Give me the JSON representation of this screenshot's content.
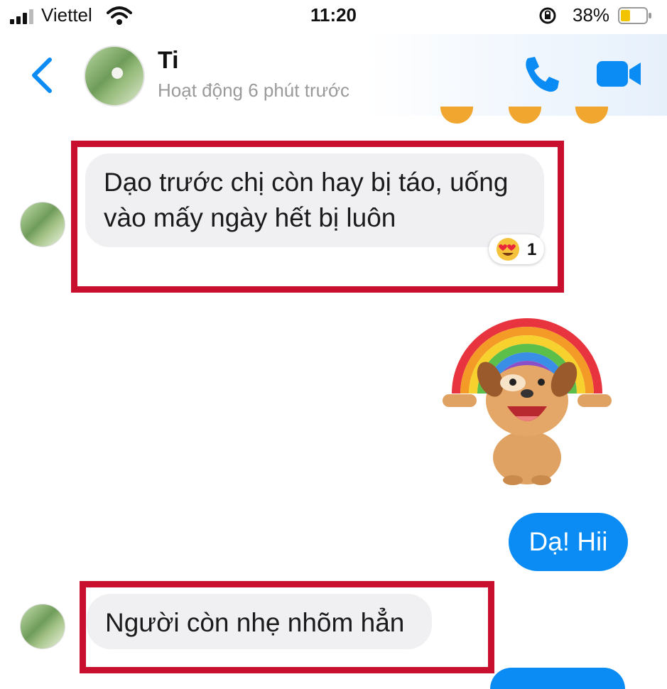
{
  "status_bar": {
    "carrier": "Viettel",
    "time": "11:20",
    "battery_percent": "38%",
    "battery_level": 0.38
  },
  "header": {
    "contact_name": "Ti",
    "contact_status": "Hoạt động 6 phút trước",
    "back_icon": "chevron-left-icon",
    "phone_icon": "phone-icon",
    "video_icon": "video-camera-icon"
  },
  "messages": [
    {
      "direction": "incoming",
      "lines": [
        "Dạo trước chị còn hay bị táo, uống",
        "vào mấy ngày hết bị luôn"
      ],
      "reaction": {
        "emoji": "heart-eyes-emoji",
        "count": "1"
      }
    },
    {
      "direction": "outgoing",
      "type": "sticker",
      "sticker": "rainbow-dog-sticker"
    },
    {
      "direction": "outgoing",
      "text": "Dạ! Hii"
    },
    {
      "direction": "incoming",
      "text": "Người còn nhẹ nhõm hẳn"
    }
  ],
  "colors": {
    "accent": "#0a8cf4",
    "incoming_bubble": "#f0f0f3",
    "highlight_box": "#c8102e",
    "status_text": "#9a9a9a"
  }
}
